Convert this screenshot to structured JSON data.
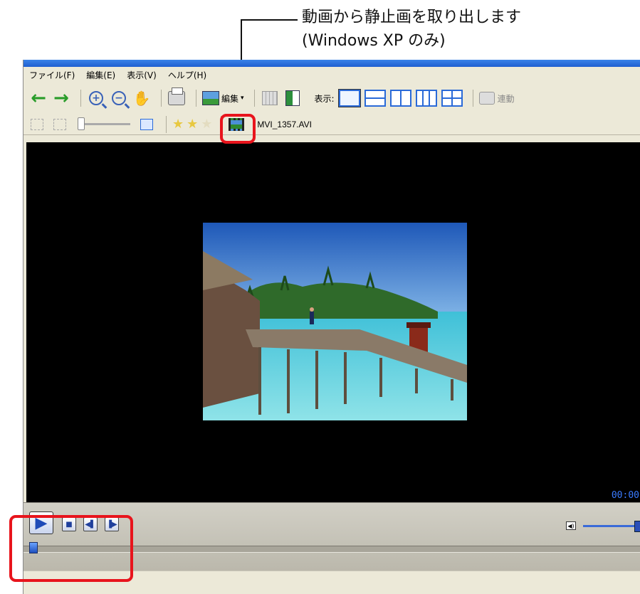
{
  "callout": {
    "line1": "動画から静止画を取り出します",
    "line2": "(Windows XP のみ)"
  },
  "menu": [
    "ファイル(F)",
    "編集(E)",
    "表示(V)",
    "ヘルプ(H)"
  ],
  "toolbar": {
    "edit_label": "編集",
    "view_label": "表示:",
    "sync_label": "連動"
  },
  "secondary_toolbar": {
    "rating_stars_filled": 2,
    "rating_stars_total": 3,
    "filename": "MVI_1357.AVI"
  },
  "player": {
    "timecode": "00:00",
    "seek_position_fraction": 0.0,
    "volume_fraction": 1.0
  },
  "colors": {
    "highlight": "#e8141c",
    "video_background": "#000000",
    "timecode": "#3a7bff"
  }
}
